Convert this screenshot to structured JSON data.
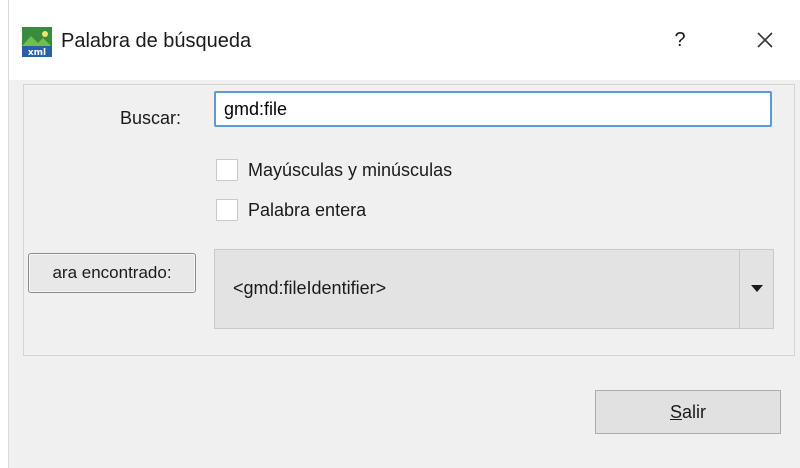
{
  "window": {
    "title": "Palabra de búsqueda",
    "help_label": "?"
  },
  "search": {
    "label": "Buscar:",
    "value": "gmd:file"
  },
  "options": {
    "match_case_label": "Mayúsculas y minúsculas",
    "match_case_checked": false,
    "whole_word_label": "Palabra entera",
    "whole_word_checked": false
  },
  "goto": {
    "button_label": "ara encontrado:"
  },
  "results": {
    "selected": "<gmd:fileIdentifier>"
  },
  "footer": {
    "exit_label_underlined": "S",
    "exit_label_rest": "alir"
  },
  "icons": {
    "app": "xml-file-icon",
    "close": "close-icon",
    "dropdown": "caret-down-icon"
  },
  "colors": {
    "focus_border": "#5b9bd5",
    "window_bg": "#f0f0f0"
  }
}
